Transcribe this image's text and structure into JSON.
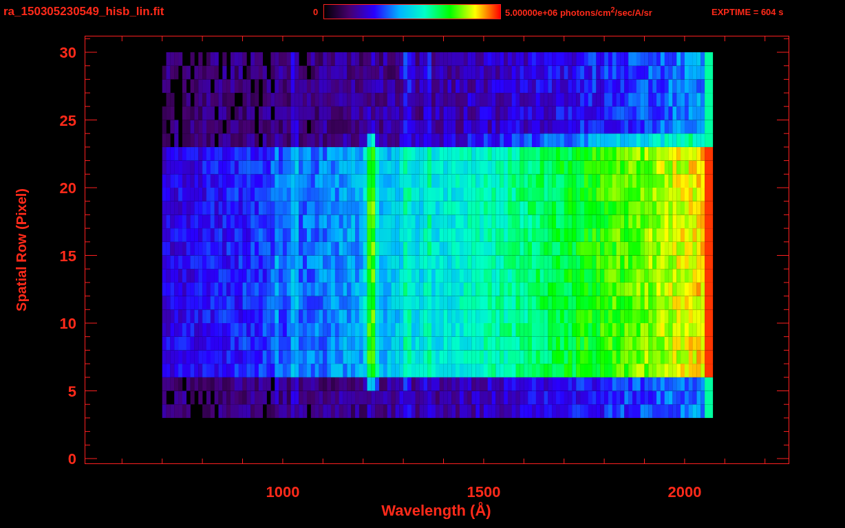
{
  "header": {
    "title": "ra_150305230549_hisb_lin.fit",
    "colorbar_min": "0",
    "colorbar_max": "5.00000e+06 photons/cm$^{2}$/sec/A/sr",
    "exptime": "EXPTIME = 604 s"
  },
  "plot": {
    "ylabel": "Spatial Row (Pixel)",
    "xlabel": "Wavelength (Å)",
    "yticks": [
      "30",
      "25",
      "20",
      "15",
      "10",
      "5",
      "0"
    ],
    "xticks": [
      "1000",
      "1500",
      "2000"
    ]
  }
}
